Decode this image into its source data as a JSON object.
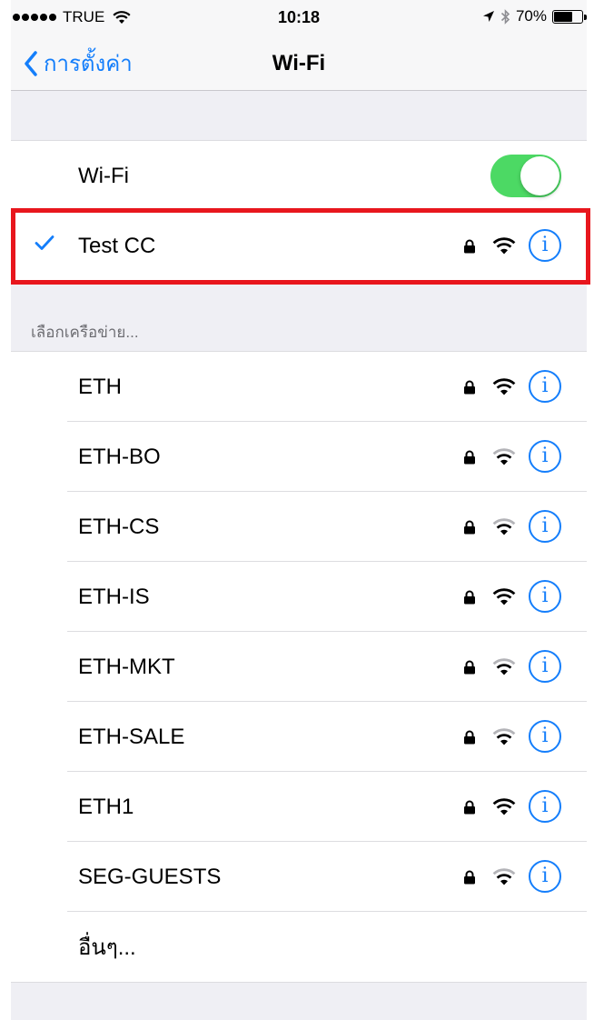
{
  "status_bar": {
    "carrier": "TRUE",
    "time": "10:18",
    "battery": "70%",
    "battery_level": 0.7
  },
  "nav": {
    "back_label": "การตั้งค่า",
    "title": "Wi-Fi"
  },
  "wifi_toggle": {
    "label": "Wi-Fi",
    "on": true
  },
  "connected_network": {
    "name": "Test CC",
    "secured": true,
    "info_glyph": "i"
  },
  "section_header": "เลือกเครือข่าย...",
  "networks": [
    {
      "name": "ETH",
      "secured": true,
      "signal": "strong"
    },
    {
      "name": "ETH-BO",
      "secured": true,
      "signal": "medium"
    },
    {
      "name": "ETH-CS",
      "secured": true,
      "signal": "medium"
    },
    {
      "name": "ETH-IS",
      "secured": true,
      "signal": "strong"
    },
    {
      "name": "ETH-MKT",
      "secured": true,
      "signal": "medium"
    },
    {
      "name": "ETH-SALE",
      "secured": true,
      "signal": "medium"
    },
    {
      "name": "ETH1",
      "secured": true,
      "signal": "strong"
    },
    {
      "name": "SEG-GUESTS",
      "secured": true,
      "signal": "medium"
    }
  ],
  "info_glyph": "i",
  "other_label": "อื่นๆ...",
  "colors": {
    "accent": "#147efb",
    "toggle_on": "#4cd964",
    "highlight": "#e8161d"
  }
}
